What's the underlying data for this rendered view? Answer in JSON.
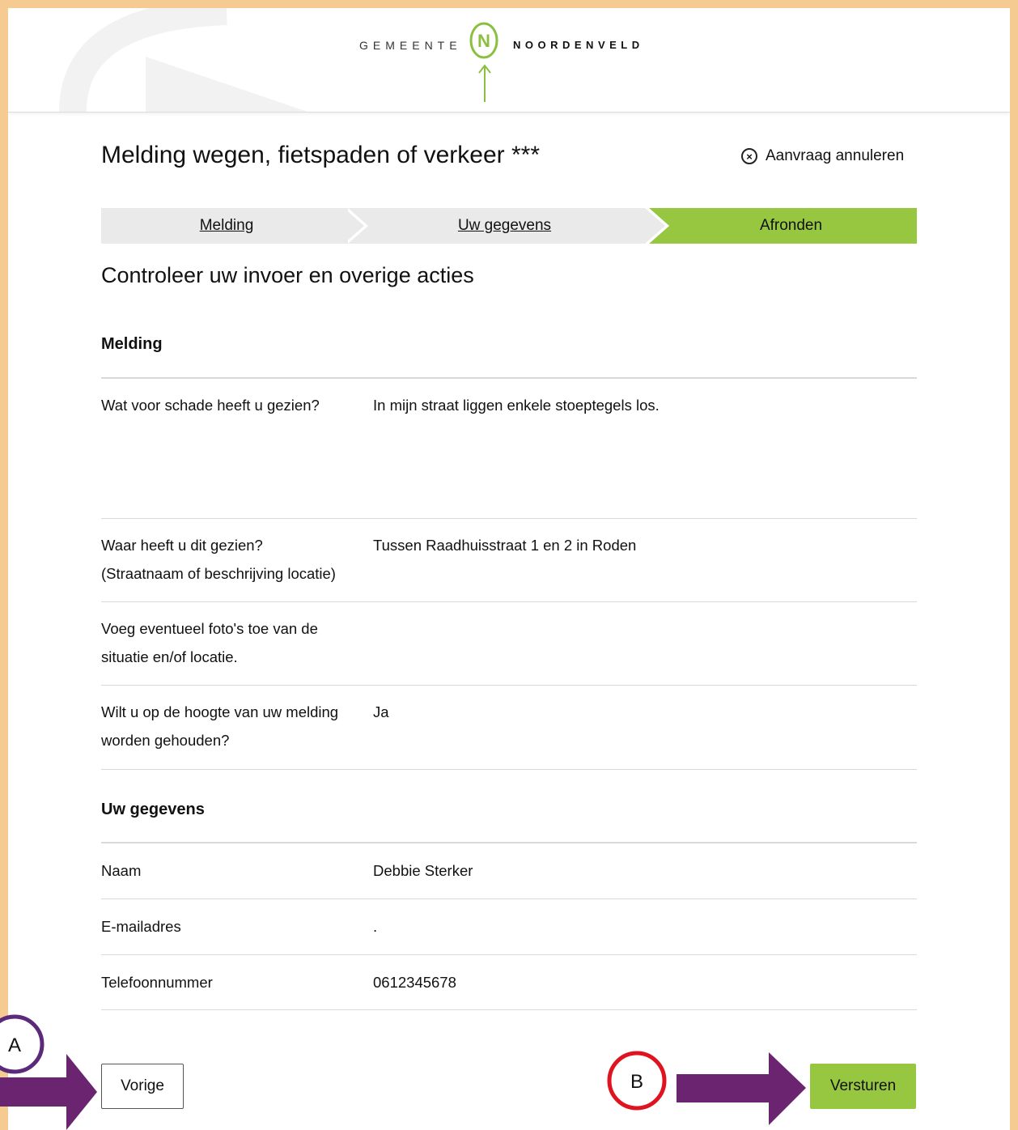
{
  "header": {
    "brand_left": "GEMEENTE",
    "brand_right": "NOORDENVELD",
    "logo_letter": "N",
    "logo_color": "#8cbf3f"
  },
  "page": {
    "title": "Melding wegen, fietspaden of verkeer ***",
    "cancel_label": "Aanvraag annuleren"
  },
  "steps": [
    {
      "label": "Melding",
      "state": "completed"
    },
    {
      "label": "Uw gegevens",
      "state": "completed"
    },
    {
      "label": "Afronden",
      "state": "active"
    }
  ],
  "review": {
    "subtitle": "Controleer uw invoer en overige acties",
    "sections": [
      {
        "heading": "Melding",
        "rows": [
          {
            "question_lines": [
              "Wat voor schade heeft u gezien?"
            ],
            "answer": "In mijn straat liggen enkele stoeptegels los."
          },
          {
            "question_lines": [
              "Waar heeft u dit gezien?",
              "(Straatnaam of beschrijving locatie)"
            ],
            "answer": "Tussen Raadhuisstraat 1 en 2 in Roden"
          },
          {
            "question_lines": [
              "Voeg eventueel foto's toe van de",
              "situatie en/of locatie."
            ],
            "answer": ""
          },
          {
            "question_lines": [
              "Wilt u op de hoogte van uw melding",
              "worden gehouden?"
            ],
            "answer": "Ja"
          }
        ]
      },
      {
        "heading": "Uw gegevens",
        "rows": [
          {
            "question_lines": [
              "Naam"
            ],
            "answer": "Debbie Sterker"
          },
          {
            "question_lines": [
              "E-mailadres"
            ],
            "answer": "."
          },
          {
            "question_lines": [
              "Telefoonnummer"
            ],
            "answer": "0612345678"
          }
        ]
      }
    ]
  },
  "buttons": {
    "previous": "Vorige",
    "submit": "Versturen"
  },
  "annotations": {
    "marker_a": "A",
    "marker_b": "B",
    "arrow_color": "#6b2470",
    "marker_a_color": "#5b2a7a",
    "marker_b_color": "#e0141e"
  },
  "colors": {
    "accent_green": "#97c741",
    "step_inactive": "#eaeaea",
    "frame": "#f6cb91"
  }
}
